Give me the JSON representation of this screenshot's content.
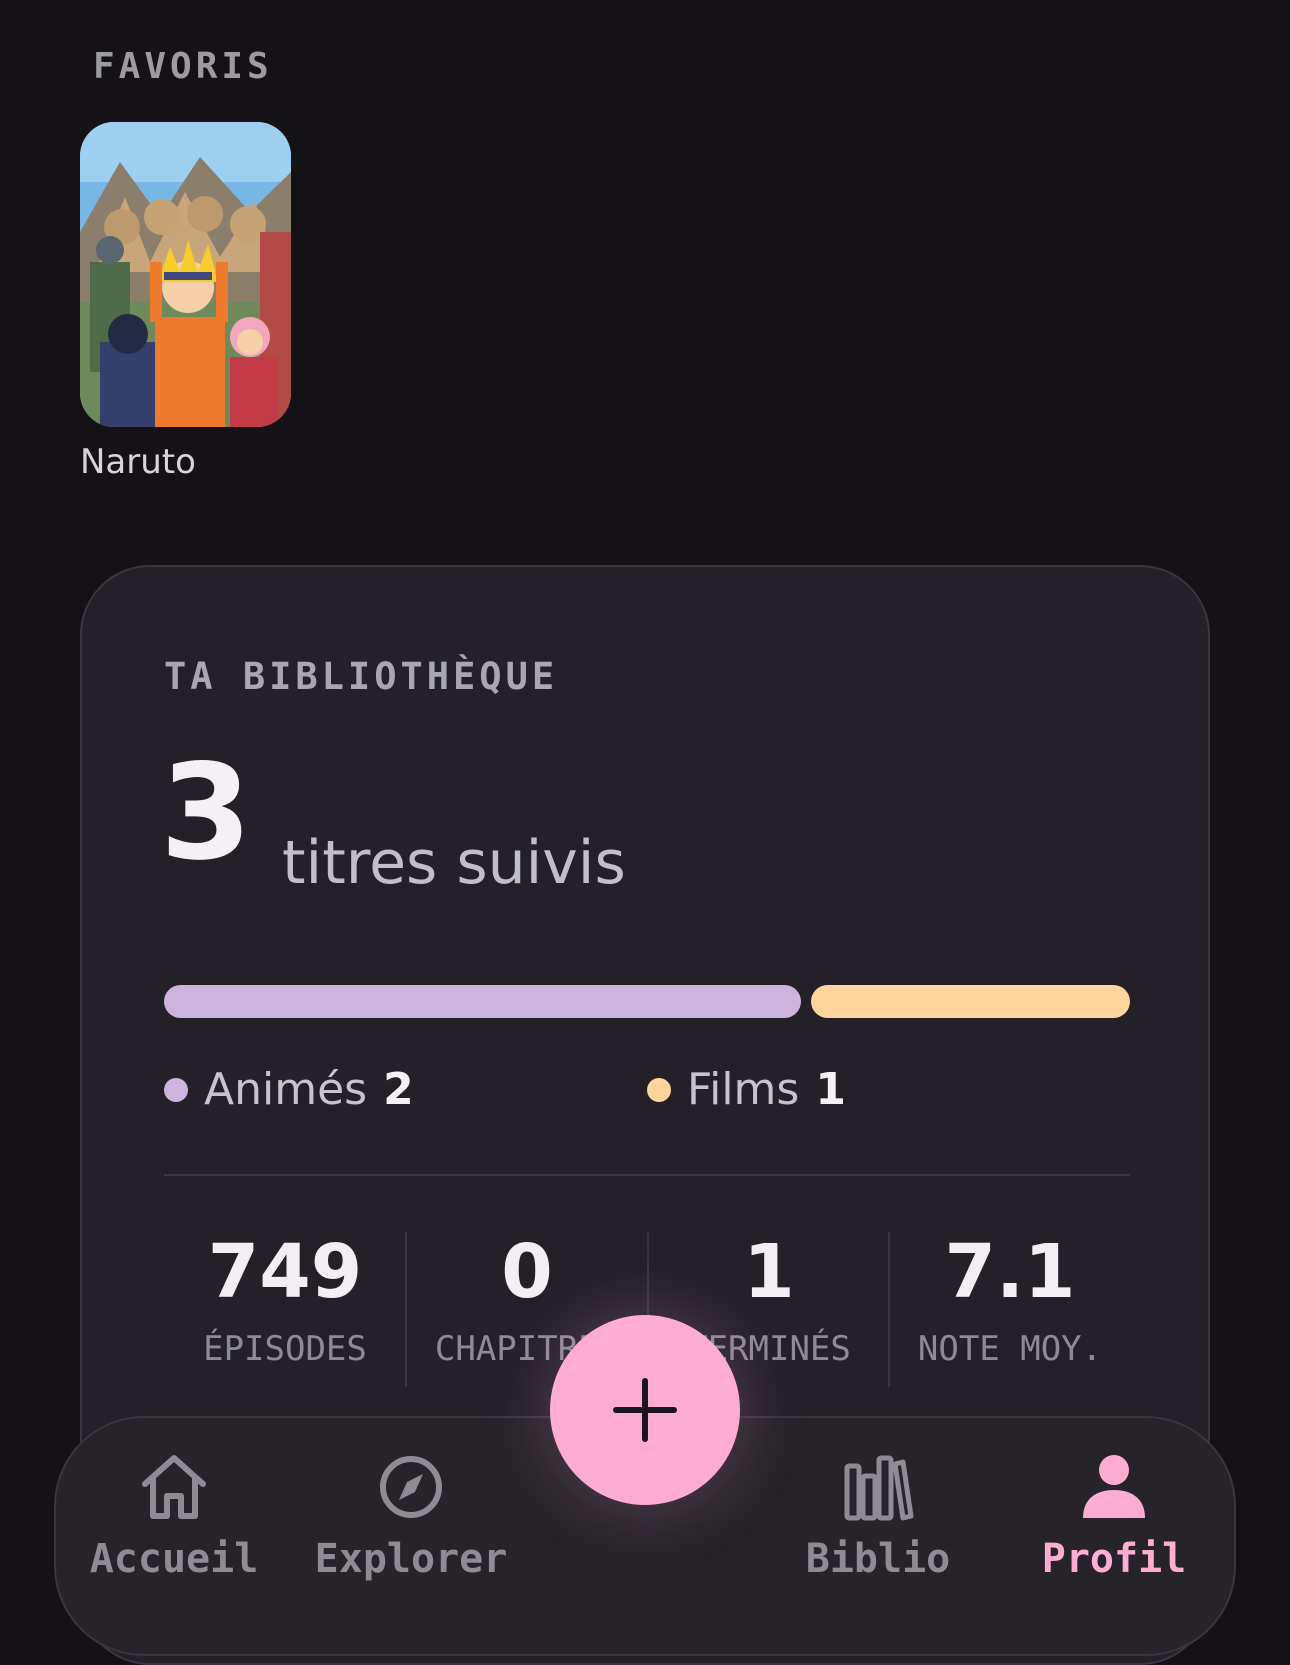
{
  "favorites": {
    "label": "FAVORIS",
    "items": [
      {
        "title": "Naruto"
      }
    ]
  },
  "library": {
    "heading": "TA BIBLIOTHÈQUE",
    "count": "3",
    "count_label": "titres suivis",
    "breakdown": [
      {
        "label": "Animés",
        "value": "2",
        "share": 0.6667,
        "color": "#cdb4dd"
      },
      {
        "label": "Films",
        "value": "1",
        "share": 0.3333,
        "color": "#ffd59c"
      }
    ],
    "stats": [
      {
        "value": "749",
        "label": "ÉPISODES"
      },
      {
        "value": "0",
        "label": "CHAPITRES"
      },
      {
        "value": "1",
        "label": "TERMINÉS"
      },
      {
        "value": "7.1",
        "label": "NOTE MOY."
      }
    ]
  },
  "nav": {
    "items": [
      {
        "label": "Accueil",
        "icon": "home-icon",
        "active": false
      },
      {
        "label": "Explorer",
        "icon": "compass-icon",
        "active": false
      },
      {
        "label": "Biblio",
        "icon": "library-icon",
        "active": false
      },
      {
        "label": "Profil",
        "icon": "person-icon",
        "active": true
      }
    ],
    "fab_icon": "plus-icon"
  },
  "colors": {
    "background": "#141117",
    "card": "#232027",
    "accent": "#ffacd1",
    "anime": "#cdb4dd",
    "films": "#ffd59c"
  }
}
